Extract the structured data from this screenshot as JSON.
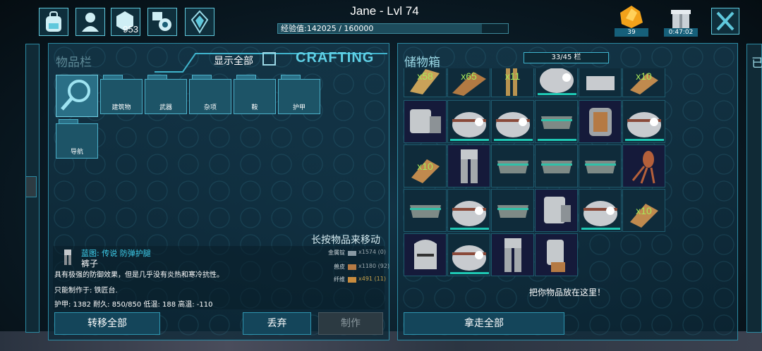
{
  "top": {
    "title": "Jane - Lvl 74",
    "xp_label": "经验值:142025 / 160000",
    "xp_fraction": 0.888,
    "engram_points": "953",
    "resource_count": "39",
    "gift_timer": "0:47:02"
  },
  "inventory": {
    "title": "物品栏",
    "show_all_label": "显示全部",
    "crafting_label": "CRAFTING",
    "folders": [
      "建筑物",
      "武器",
      "杂项",
      "鞍",
      "护甲",
      "导航"
    ],
    "hint": "长按物品来移动",
    "item": {
      "blueprint_name": "蓝图: 传说 防弹护腿",
      "name": "裤子",
      "description": "具有极强的防御效果，但是几乎没有炎热和寒冷抗性。",
      "craft_at": "只能制作于: 铁匠台.",
      "stats": "护甲: 1382 耐久: 850/850 低温: 188 高温: -110"
    },
    "costs": [
      {
        "name": "金属锭",
        "amount": "x1574 (0)"
      },
      {
        "name": "兽皮",
        "amount": "x1180 (92)"
      },
      {
        "name": "纤维",
        "amount": "x491 (11)"
      }
    ],
    "buttons": {
      "transfer_all": "转移全部",
      "drop": "丢弃",
      "craft": "制作"
    }
  },
  "storage": {
    "title": "储物箱",
    "capacity": "33/45 栏",
    "drop_hint": "把你物品放在这里！",
    "take_all": "拿走全部",
    "right_edge_char": "已"
  },
  "colors": {
    "accent": "#2c8aa3",
    "durability": "#1ec7b3",
    "quantity": "#a8e85a"
  }
}
